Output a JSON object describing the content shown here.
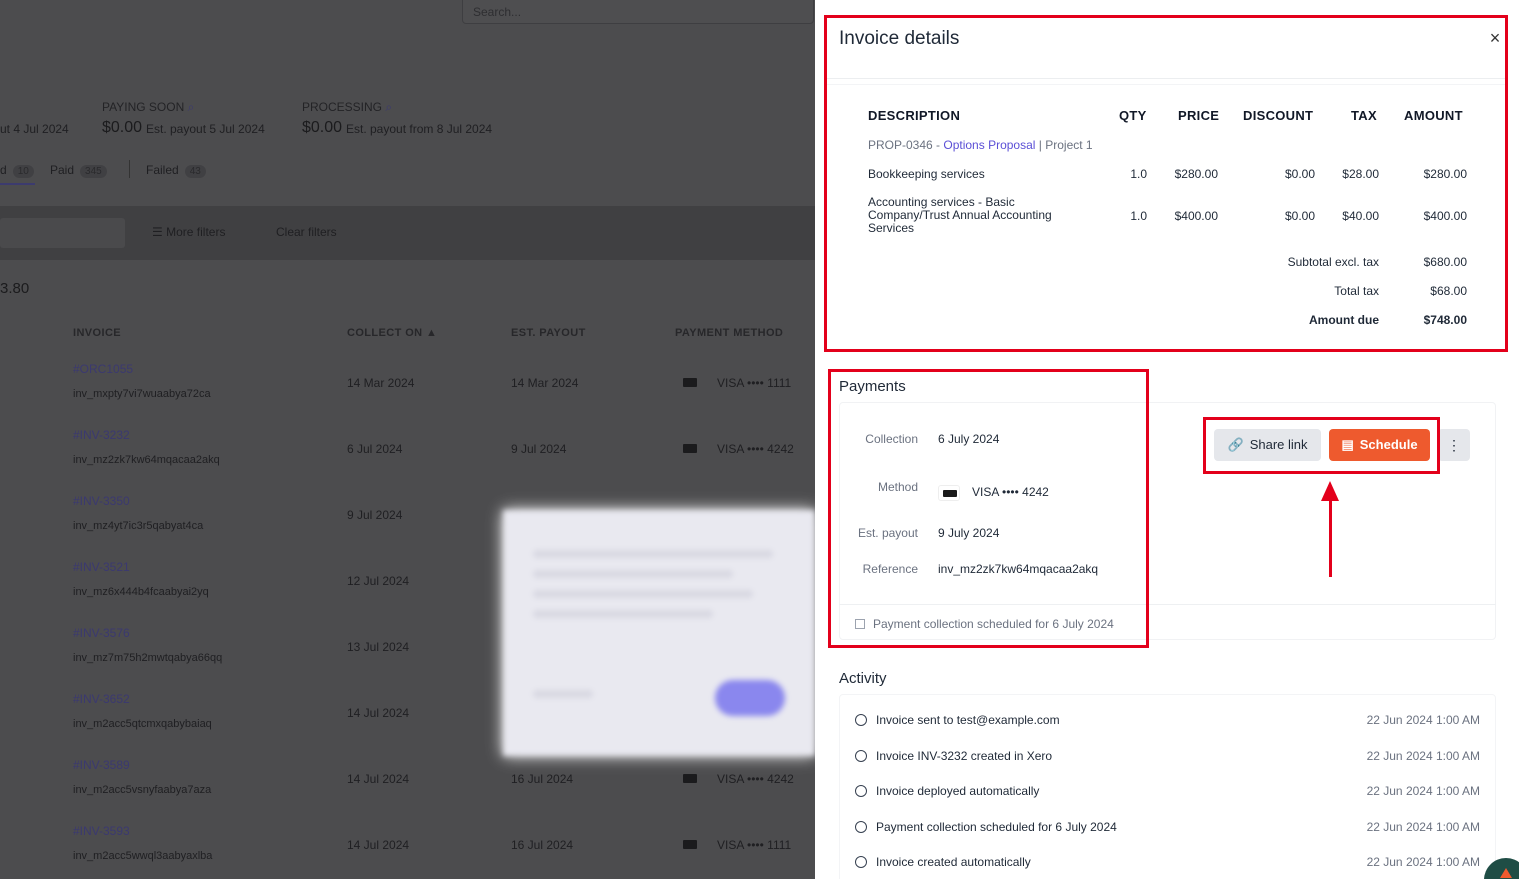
{
  "background": {
    "search_placeholder": "Search...",
    "summary": [
      {
        "label": "",
        "amount": "",
        "payout": "ut 4 Jul 2024"
      },
      {
        "label": "PAYING SOON",
        "amount": "$0.00",
        "payout": "Est. payout 5 Jul 2024"
      },
      {
        "label": "PROCESSING",
        "amount": "$0.00",
        "payout": "Est. payout from 8 Jul 2024"
      }
    ],
    "tabs": [
      {
        "label": "d",
        "count": "10"
      },
      {
        "label": "Paid",
        "count": "345"
      },
      {
        "label": "Failed",
        "count": "43"
      }
    ],
    "more_filters": "More filters",
    "clear_filters": "Clear filters",
    "total_partial": "3.80",
    "columns": {
      "invoice": "INVOICE",
      "collect_on": "COLLECT ON",
      "est_payout": "EST. PAYOUT",
      "payment_method": "PAYMENT METHOD"
    },
    "rows": [
      {
        "id": "#ORC1055",
        "ref": "inv_mxpty7vi7wuaabya72ca",
        "collect": "14 Mar 2024",
        "payout": "14 Mar 2024",
        "method": "VISA •••• 1111"
      },
      {
        "id": "#INV-3232",
        "ref": "inv_mz2zk7kw64mqacaa2akq",
        "collect": "6 Jul 2024",
        "payout": "9 Jul 2024",
        "method": "VISA •••• 4242"
      },
      {
        "id": "#INV-3350",
        "ref": "inv_mz4yt7ic3r5qabyat4ca",
        "collect": "9 Jul 2024",
        "payout": "",
        "method": ""
      },
      {
        "id": "#INV-3521",
        "ref": "inv_mz6x444b4fcaabyai2yq",
        "collect": "12 Jul 2024",
        "payout": "",
        "method": ""
      },
      {
        "id": "#INV-3576",
        "ref": "inv_mz7m75h2mwtqabya66qq",
        "collect": "13 Jul 2024",
        "payout": "",
        "method": ""
      },
      {
        "id": "#INV-3652",
        "ref": "inv_m2acc5qtcmxqabybaiaq",
        "collect": "14 Jul 2024",
        "payout": "",
        "method": ""
      },
      {
        "id": "#INV-3589",
        "ref": "inv_m2acc5vsnyfaabya7aza",
        "collect": "14 Jul 2024",
        "payout": "16 Jul 2024",
        "method": "VISA •••• 4242"
      },
      {
        "id": "#INV-3593",
        "ref": "inv_m2acc5wwql3aabyaxlba",
        "collect": "14 Jul 2024",
        "payout": "16 Jul 2024",
        "method": "VISA •••• 1111"
      }
    ]
  },
  "panel": {
    "title": "Invoice details",
    "close": "×",
    "table_headers": {
      "description": "DESCRIPTION",
      "qty": "QTY",
      "price": "PRICE",
      "discount": "DISCOUNT",
      "tax": "TAX",
      "amount": "AMOUNT"
    },
    "project": {
      "prefix": "PROP-0346 - ",
      "link": "Options Proposal",
      "suffix": " | Project 1"
    },
    "line_items": [
      {
        "description": "Bookkeeping services",
        "qty": "1.0",
        "price": "$280.00",
        "discount": "$0.00",
        "tax": "$28.00",
        "amount": "$280.00"
      },
      {
        "description": "Accounting services - Basic Company/Trust Annual Accounting Services",
        "qty": "1.0",
        "price": "$400.00",
        "discount": "$0.00",
        "tax": "$40.00",
        "amount": "$400.00"
      }
    ],
    "totals": {
      "subtotal_label": "Subtotal excl. tax",
      "subtotal": "$680.00",
      "tax_label": "Total tax",
      "tax": "$68.00",
      "due_label": "Amount due",
      "due": "$748.00"
    },
    "payments": {
      "title": "Payments",
      "collection_label": "Collection",
      "collection": "6 July 2024",
      "method_label": "Method",
      "method": "VISA •••• 4242",
      "payout_label": "Est. payout",
      "payout": "9 July 2024",
      "reference_label": "Reference",
      "reference": "inv_mz2zk7kw64mqacaa2akq",
      "note": "Payment collection scheduled for 6 July 2024",
      "share_link": "Share link",
      "schedule": "Schedule",
      "more": "⋮"
    },
    "activity": {
      "title": "Activity",
      "items": [
        {
          "text": "Invoice sent to test@example.com",
          "time": "22 Jun 2024 1:00 AM"
        },
        {
          "text": "Invoice INV-3232 created in Xero",
          "time": "22 Jun 2024 1:00 AM"
        },
        {
          "text": "Invoice deployed automatically",
          "time": "22 Jun 2024 1:00 AM"
        },
        {
          "text": "Payment collection scheduled for 6 July 2024",
          "time": "22 Jun 2024 1:00 AM"
        },
        {
          "text": "Invoice created automatically",
          "time": "22 Jun 2024 1:00 AM"
        }
      ]
    }
  },
  "colors": {
    "accent": "#ee5a2e",
    "link": "#5b4fd6",
    "annotation": "#e3001b",
    "overlay": "#4c4c4e"
  }
}
